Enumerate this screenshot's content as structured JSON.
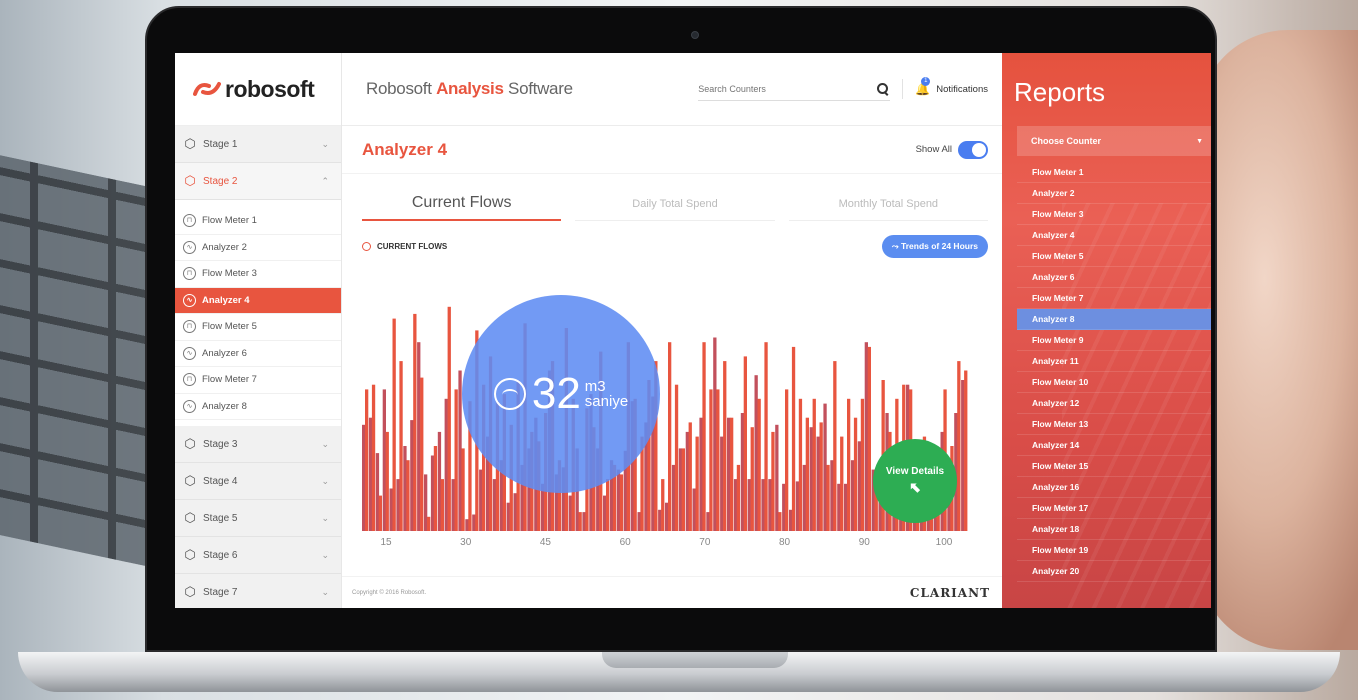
{
  "brand": {
    "logo_text": "robosoft"
  },
  "app": {
    "title_prefix": "Robosoft ",
    "title_bold": "Analysis",
    "title_suffix": " Software"
  },
  "search": {
    "placeholder": "Search Counters"
  },
  "notifications": {
    "label": "Notifications",
    "badge": "1"
  },
  "sidebar": {
    "stages_top": [
      {
        "label": "Stage 1",
        "chevron": "⌄"
      },
      {
        "label": "Stage 2",
        "chevron": "⌃"
      }
    ],
    "sub_items": [
      {
        "label": "Flow Meter 1",
        "icon": "flow-meter-icon"
      },
      {
        "label": "Analyzer 2",
        "icon": "analyzer-icon"
      },
      {
        "label": "Flow Meter 3",
        "icon": "flow-meter-icon"
      },
      {
        "label": "Analyzer 4",
        "icon": "analyzer-icon"
      },
      {
        "label": "Flow Meter 5",
        "icon": "flow-meter-icon"
      },
      {
        "label": "Analyzer 6",
        "icon": "analyzer-icon"
      },
      {
        "label": "Flow Meter 7",
        "icon": "flow-meter-icon"
      },
      {
        "label": "Analyzer 8",
        "icon": "analyzer-icon"
      }
    ],
    "stages_bottom": [
      {
        "label": "Stage 3",
        "chevron": "⌄"
      },
      {
        "label": "Stage 4",
        "chevron": "⌄"
      },
      {
        "label": "Stage 5",
        "chevron": "⌄"
      },
      {
        "label": "Stage 6",
        "chevron": "⌄"
      },
      {
        "label": "Stage 7",
        "chevron": "⌄"
      }
    ]
  },
  "page": {
    "title": "Analyzer 4",
    "show_all_label": "Show All",
    "show_all_on": true,
    "tabs": [
      "Current Flows",
      "Daily Total Spend",
      "Monthly Total Spend"
    ],
    "active_tab": 0,
    "section_label": "CURRENT FLOWS",
    "trend_button": "Trends of 24 Hours"
  },
  "bubble": {
    "value": "32",
    "unit_top": "m3",
    "unit_bottom": "saniye"
  },
  "view_details": {
    "label": "View Details"
  },
  "footer": {
    "copyright": "Copyright © 2016 Robosoft.",
    "brand": "CLARIANT"
  },
  "reports": {
    "title": "Reports",
    "choose_label": "Choose Counter",
    "items": [
      "Flow Meter 1",
      "Analyzer 2",
      "Flow Meter 3",
      "Analyzer 4",
      "Flow Meter 5",
      "Analyzer 6",
      "Flow Meter 7",
      "Analyzer 8",
      "Flow Meter 9",
      "Analyzer 11",
      "Flow Meter 10",
      "Analyzer 12",
      "Flow Meter 13",
      "Analyzer 14",
      "Flow Meter 15",
      "Analyzer 16",
      "Flow Meter 17",
      "Analyzer 18",
      "Flow Meter 19",
      "Analyzer 20"
    ],
    "selected_index": 7
  },
  "colors": {
    "accent": "#e8553f",
    "blue": "#4a7df0",
    "green": "#2dad53",
    "bar_a": "#e8553f",
    "bar_b": "#c2505c"
  },
  "chart_data": {
    "type": "bar",
    "xticks": [
      "15",
      "30",
      "45",
      "60",
      "70",
      "80",
      "90",
      "100"
    ],
    "ylim": [
      0,
      100
    ],
    "series": [
      {
        "values": [
          45,
          48,
          33,
          60,
          18,
          22,
          36,
          47,
          80,
          24,
          32,
          42,
          56,
          22,
          68,
          5,
          7,
          26,
          40,
          22,
          30,
          12,
          16,
          28,
          35,
          48,
          20,
          68,
          24,
          27,
          15,
          35,
          8,
          58,
          35,
          15,
          30,
          26,
          34,
          55,
          8,
          46,
          57,
          9,
          12,
          28,
          35,
          42,
          18,
          48,
          8,
          82,
          40,
          48,
          22,
          50,
          22,
          66,
          22,
          22,
          45,
          20,
          9,
          21,
          28,
          44,
          40,
          54,
          30,
          20,
          20,
          30,
          38,
          80,
          26,
          18,
          50,
          18,
          34,
          62,
          8,
          22,
          33,
          18,
          42,
          12,
          50,
          64
        ]
      },
      {
        "values": [
          60,
          62,
          15,
          42,
          90,
          72,
          30,
          92,
          65,
          6,
          36,
          22,
          95,
          60,
          35,
          55,
          85,
          62,
          74,
          55,
          58,
          45,
          64,
          88,
          42,
          38,
          50,
          72,
          30,
          86,
          56,
          8,
          52,
          44,
          76,
          22,
          28,
          24,
          80,
          56,
          40,
          64,
          72,
          22,
          80,
          62,
          35,
          46,
          40,
          80,
          60,
          60,
          72,
          48,
          28,
          74,
          44,
          56,
          80,
          42,
          8,
          60,
          78,
          56,
          48,
          56,
          46,
          28,
          72,
          40,
          56,
          48,
          56,
          78,
          25,
          64,
          42,
          56,
          62,
          60,
          18,
          40,
          22,
          32,
          60,
          36,
          72,
          68
        ]
      }
    ]
  }
}
